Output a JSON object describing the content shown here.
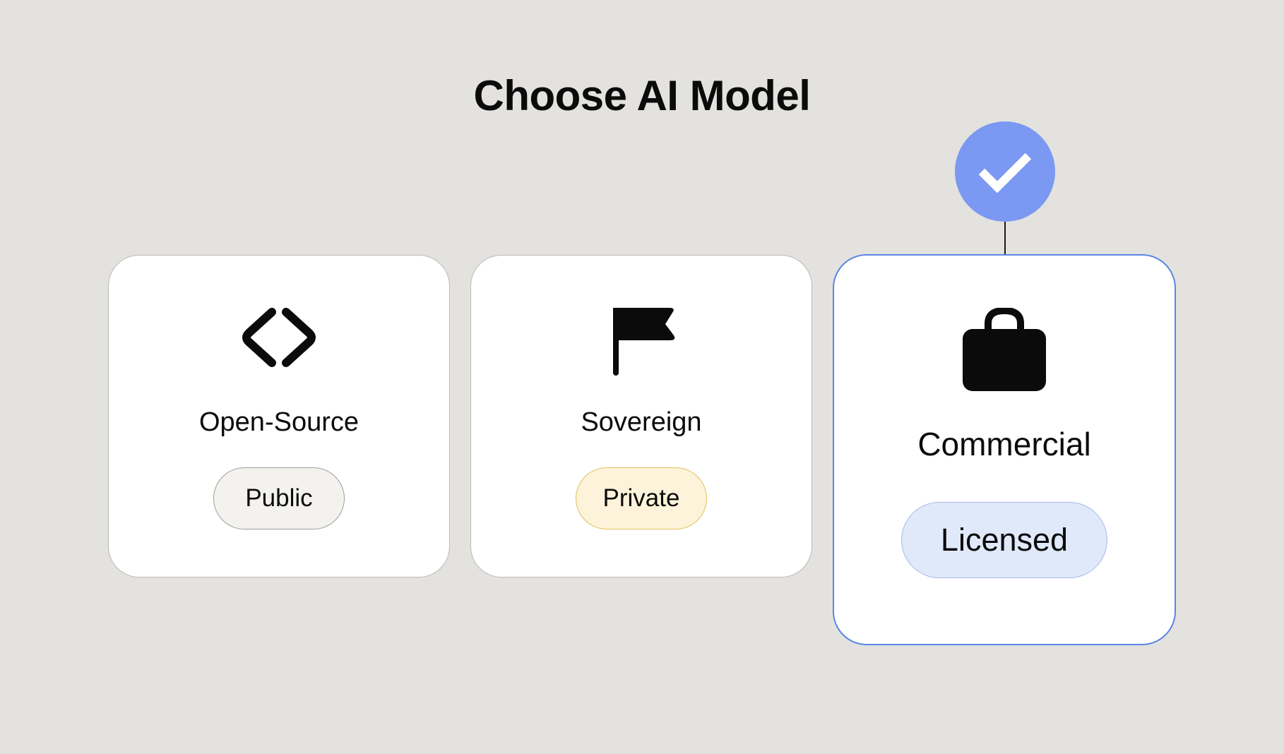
{
  "page": {
    "title": "Choose AI Model"
  },
  "options": [
    {
      "label": "Open-Source",
      "badge": "Public",
      "icon": "code-brackets-icon",
      "selected": false
    },
    {
      "label": "Sovereign",
      "badge": "Private",
      "icon": "flag-icon",
      "selected": false
    },
    {
      "label": "Commercial",
      "badge": "Licensed",
      "icon": "briefcase-icon",
      "selected": true
    }
  ],
  "colors": {
    "background": "#e3e2de",
    "selected_accent": "#5b86e5",
    "check_badge": "#7b98f2",
    "public_pill": "#f3f2ee",
    "private_pill": "#fcf3da",
    "licensed_pill": "#e0e9fa"
  }
}
